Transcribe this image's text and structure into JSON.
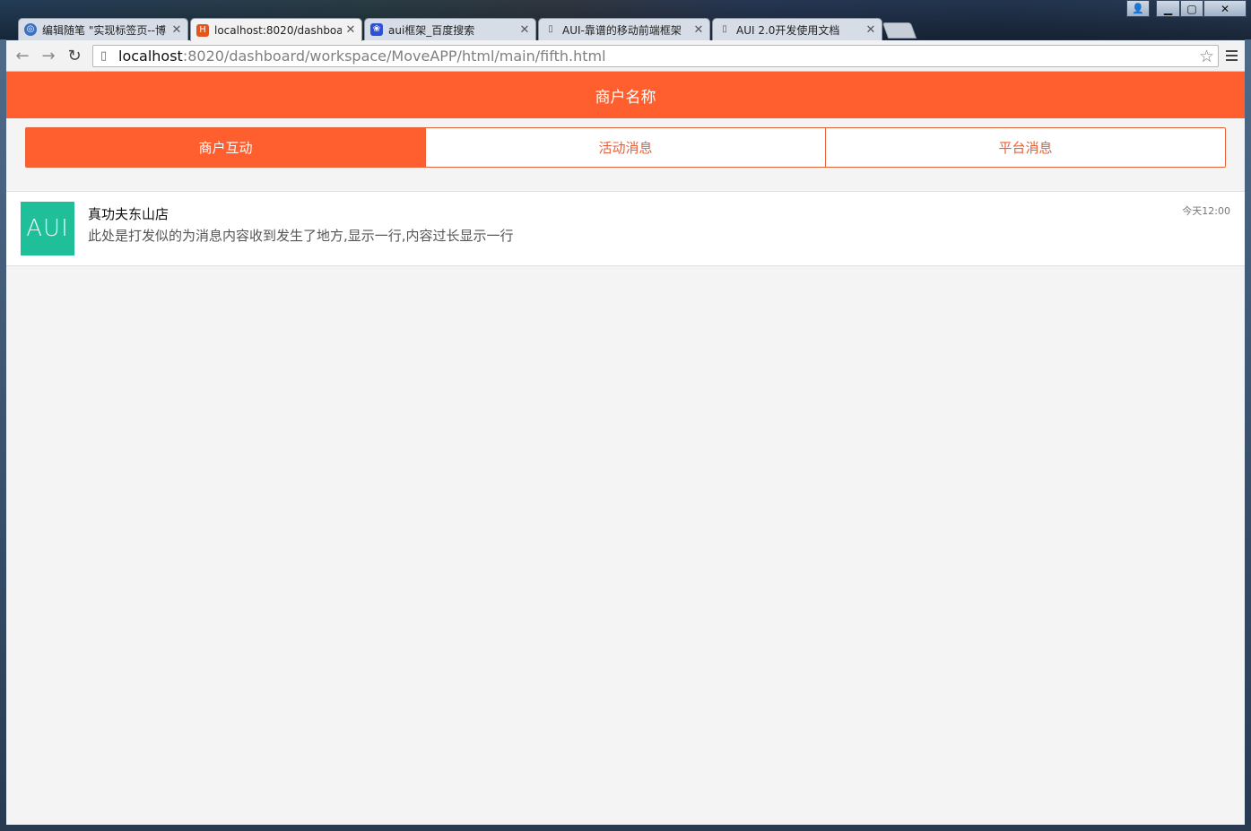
{
  "browser": {
    "tabs": [
      {
        "label": "编辑随笔 \"实现标签页--博",
        "favicon": "cnblogs-icon",
        "active": false
      },
      {
        "label": "localhost:8020/dashboa",
        "favicon": "hbuilder-icon",
        "active": true
      },
      {
        "label": "aui框架_百度搜索",
        "favicon": "baidu-icon",
        "active": false
      },
      {
        "label": "AUI-靠谱的移动前端框架",
        "favicon": "page-icon",
        "active": false
      },
      {
        "label": "AUI 2.0开发使用文档",
        "favicon": "page-icon",
        "active": false
      }
    ],
    "url_host": "localhost",
    "url_rest": ":8020/dashboard/workspace/MoveAPP/html/main/fifth.html"
  },
  "app": {
    "header_title": "商户名称",
    "segments": [
      {
        "label": "商户互动",
        "active": true
      },
      {
        "label": "活动消息",
        "active": false
      },
      {
        "label": "平台消息",
        "active": false
      }
    ],
    "messages": [
      {
        "avatar_text": "AUI",
        "title": "真功夫东山店",
        "text": "此处是打发似的为消息内容收到发生了地方,显示一行,内容过长显示一行",
        "time": "今天12:00"
      }
    ]
  },
  "colors": {
    "brand": "#ff5f2e",
    "avatar": "#1fbf99",
    "background": "#f4f4f4"
  }
}
